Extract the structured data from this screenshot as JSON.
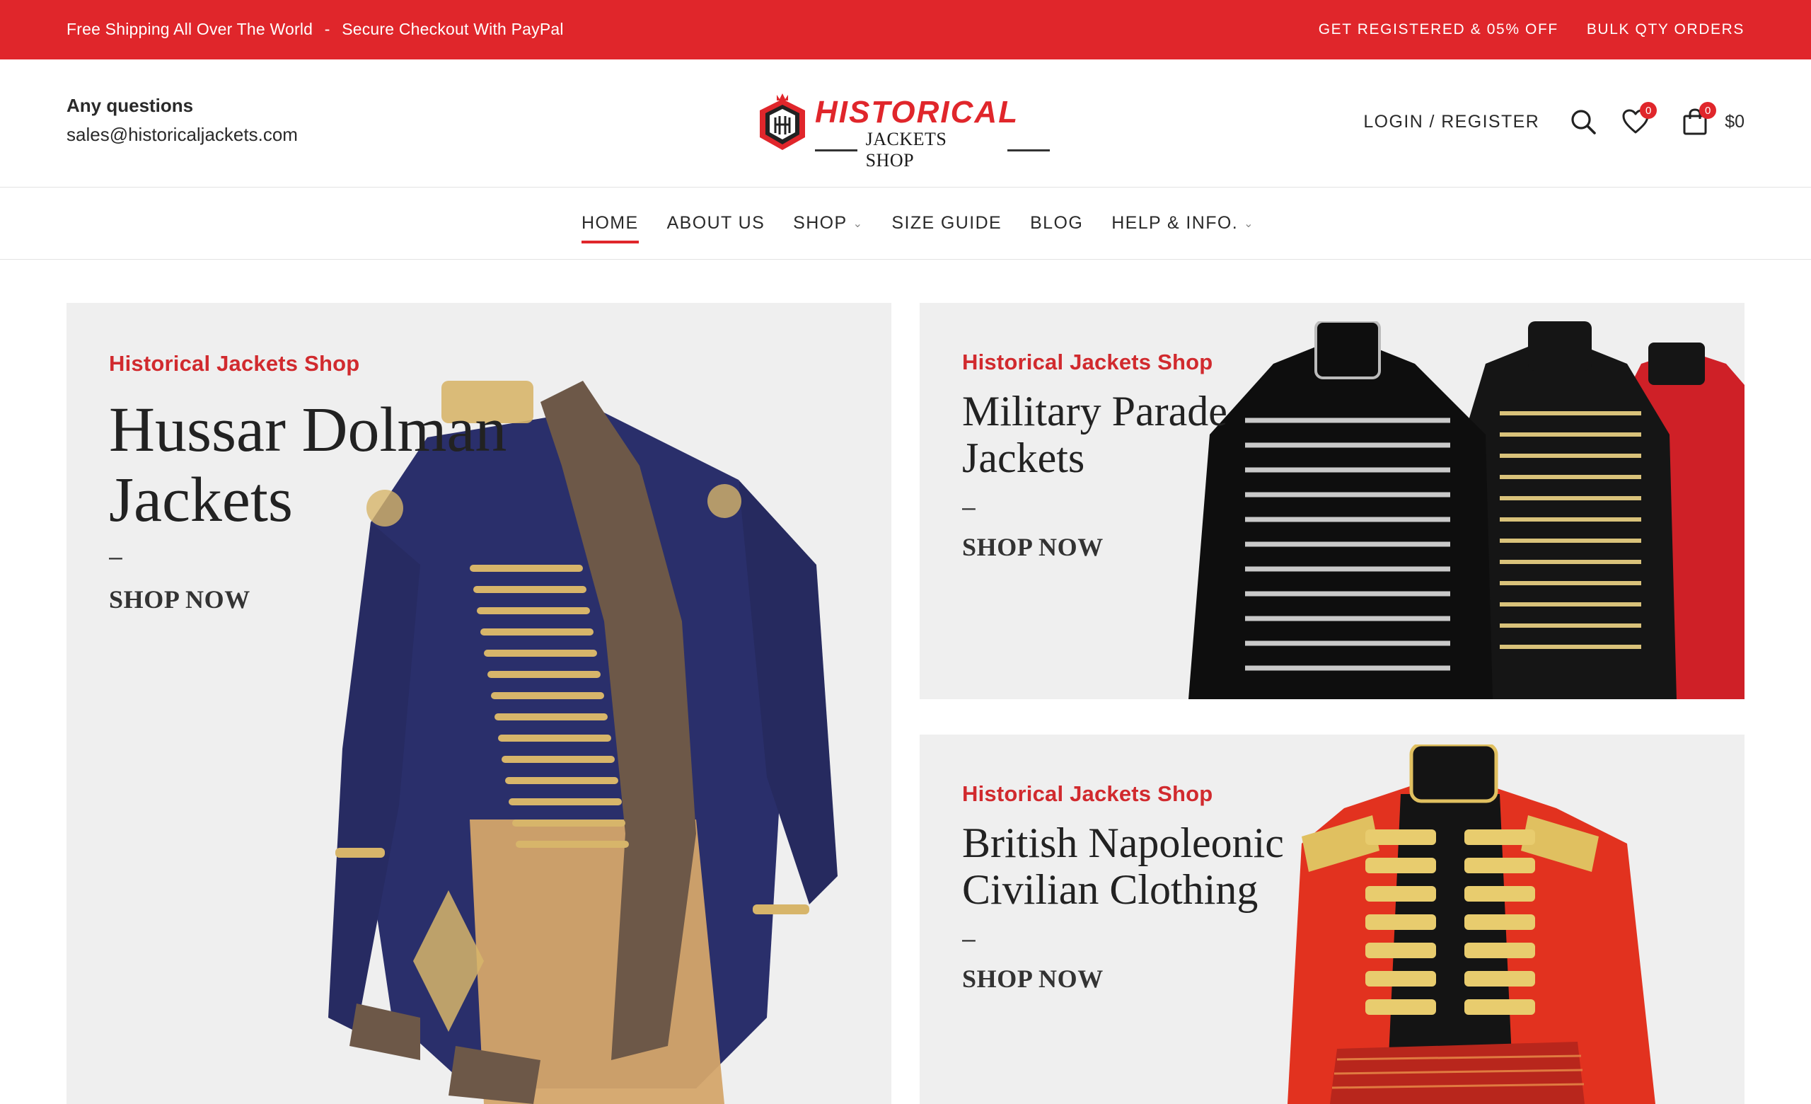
{
  "topbar": {
    "left_1": "Free Shipping All Over The World",
    "separator": "-",
    "left_2": "Secure Checkout With PayPal",
    "registered": "GET REGISTERED & 05% OFF",
    "bulk": "BULK QTY ORDERS",
    "color": "#e0262b"
  },
  "header": {
    "questions": "Any questions",
    "email": "sales@historicaljackets.com",
    "logo_word": "HISTORICAL",
    "logo_sub": "JACKETS SHOP",
    "login": "LOGIN / REGISTER",
    "wishlist_count": "0",
    "cart_count": "0",
    "cart_total": "$0"
  },
  "nav": {
    "items": [
      {
        "label": "HOME"
      },
      {
        "label": "ABOUT US"
      },
      {
        "label": "SHOP"
      },
      {
        "label": "SIZE GUIDE"
      },
      {
        "label": "BLOG"
      },
      {
        "label": "HELP & INFO."
      }
    ]
  },
  "banners": [
    {
      "kicker": "Historical Jackets Shop",
      "title": "Hussar Dolman Jackets",
      "dash": "–",
      "cta": "SHOP NOW"
    },
    {
      "kicker": "Historical Jackets Shop",
      "title": "Military Parade Jackets",
      "dash": "–",
      "cta": "SHOP NOW"
    },
    {
      "kicker": "Historical Jackets Shop",
      "title": "British Napoleonic Civilian Clothing",
      "dash": "–",
      "cta": "SHOP NOW"
    }
  ]
}
